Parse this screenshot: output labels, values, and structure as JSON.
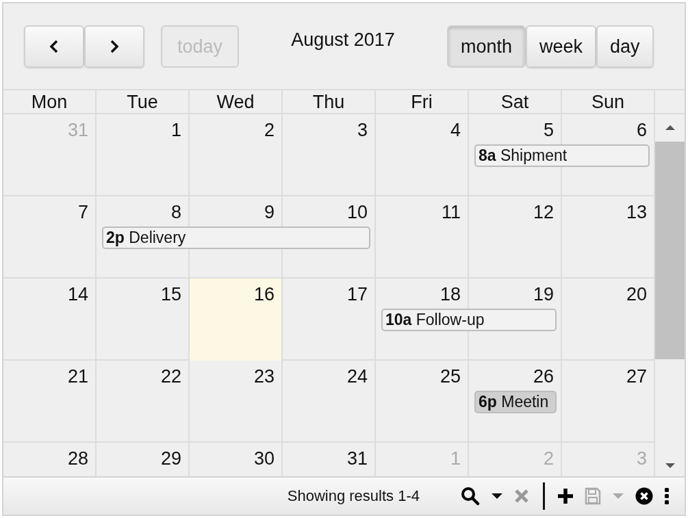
{
  "toolbar": {
    "nav_buttons": [
      {
        "kind": "prev"
      },
      {
        "kind": "next"
      }
    ],
    "today_button": {
      "label": "today",
      "disabled": true
    },
    "title": "August 2017",
    "views": [
      {
        "label": "month",
        "selected": true
      },
      {
        "label": "week",
        "selected": false
      },
      {
        "label": "day",
        "selected": false
      }
    ]
  },
  "weekdays": [
    "Mon",
    "Tue",
    "Wed",
    "Thu",
    "Fri",
    "Sat",
    "Sun"
  ],
  "weeks": [
    {
      "days": [
        {
          "label": "31",
          "other_month": true
        },
        {
          "label": "1"
        },
        {
          "label": "2"
        },
        {
          "label": "3"
        },
        {
          "label": "4"
        },
        {
          "label": "5",
          "event": {
            "time": "8a",
            "title": "Shipment",
            "selected": false
          }
        },
        {
          "label": "6",
          "continued": true
        }
      ]
    },
    {
      "days": [
        {
          "label": "7"
        },
        {
          "label": "8",
          "event": {
            "time": "2p",
            "title": "Delivery",
            "selected": false
          }
        },
        {
          "label": "9",
          "continued": true
        },
        {
          "label": "10",
          "continued": true
        },
        {
          "label": "11"
        },
        {
          "label": "12"
        },
        {
          "label": "13"
        }
      ]
    },
    {
      "days": [
        {
          "label": "14"
        },
        {
          "label": "15"
        },
        {
          "label": "16",
          "today": true
        },
        {
          "label": "17"
        },
        {
          "label": "18",
          "event": {
            "time": "10a",
            "title": "Follow-up",
            "selected": false
          }
        },
        {
          "label": "19",
          "continued": true
        },
        {
          "label": "20"
        }
      ]
    },
    {
      "days": [
        {
          "label": "21"
        },
        {
          "label": "22"
        },
        {
          "label": "23"
        },
        {
          "label": "24"
        },
        {
          "label": "25"
        },
        {
          "label": "26",
          "event": {
            "time": "6p",
            "title": "Meetin",
            "selected": true
          }
        },
        {
          "label": "27"
        }
      ]
    },
    {
      "days": [
        {
          "label": "28"
        },
        {
          "label": "29"
        },
        {
          "label": "30"
        },
        {
          "label": "31"
        },
        {
          "label": "1",
          "other_month": true
        },
        {
          "label": "2",
          "other_month": true
        },
        {
          "label": "3",
          "other_month": true
        }
      ]
    }
  ],
  "status_bar": {
    "text": "Showing results 1-4",
    "tools": [
      {
        "kind": "search",
        "disabled": false
      },
      {
        "kind": "caret",
        "disabled": false
      },
      {
        "kind": "clear",
        "disabled": true
      },
      {
        "kind": "separator"
      },
      {
        "kind": "add",
        "disabled": false
      },
      {
        "kind": "save",
        "disabled": true
      },
      {
        "kind": "caret",
        "disabled": true
      },
      {
        "kind": "close",
        "disabled": false
      },
      {
        "kind": "more",
        "disabled": false
      }
    ]
  }
}
